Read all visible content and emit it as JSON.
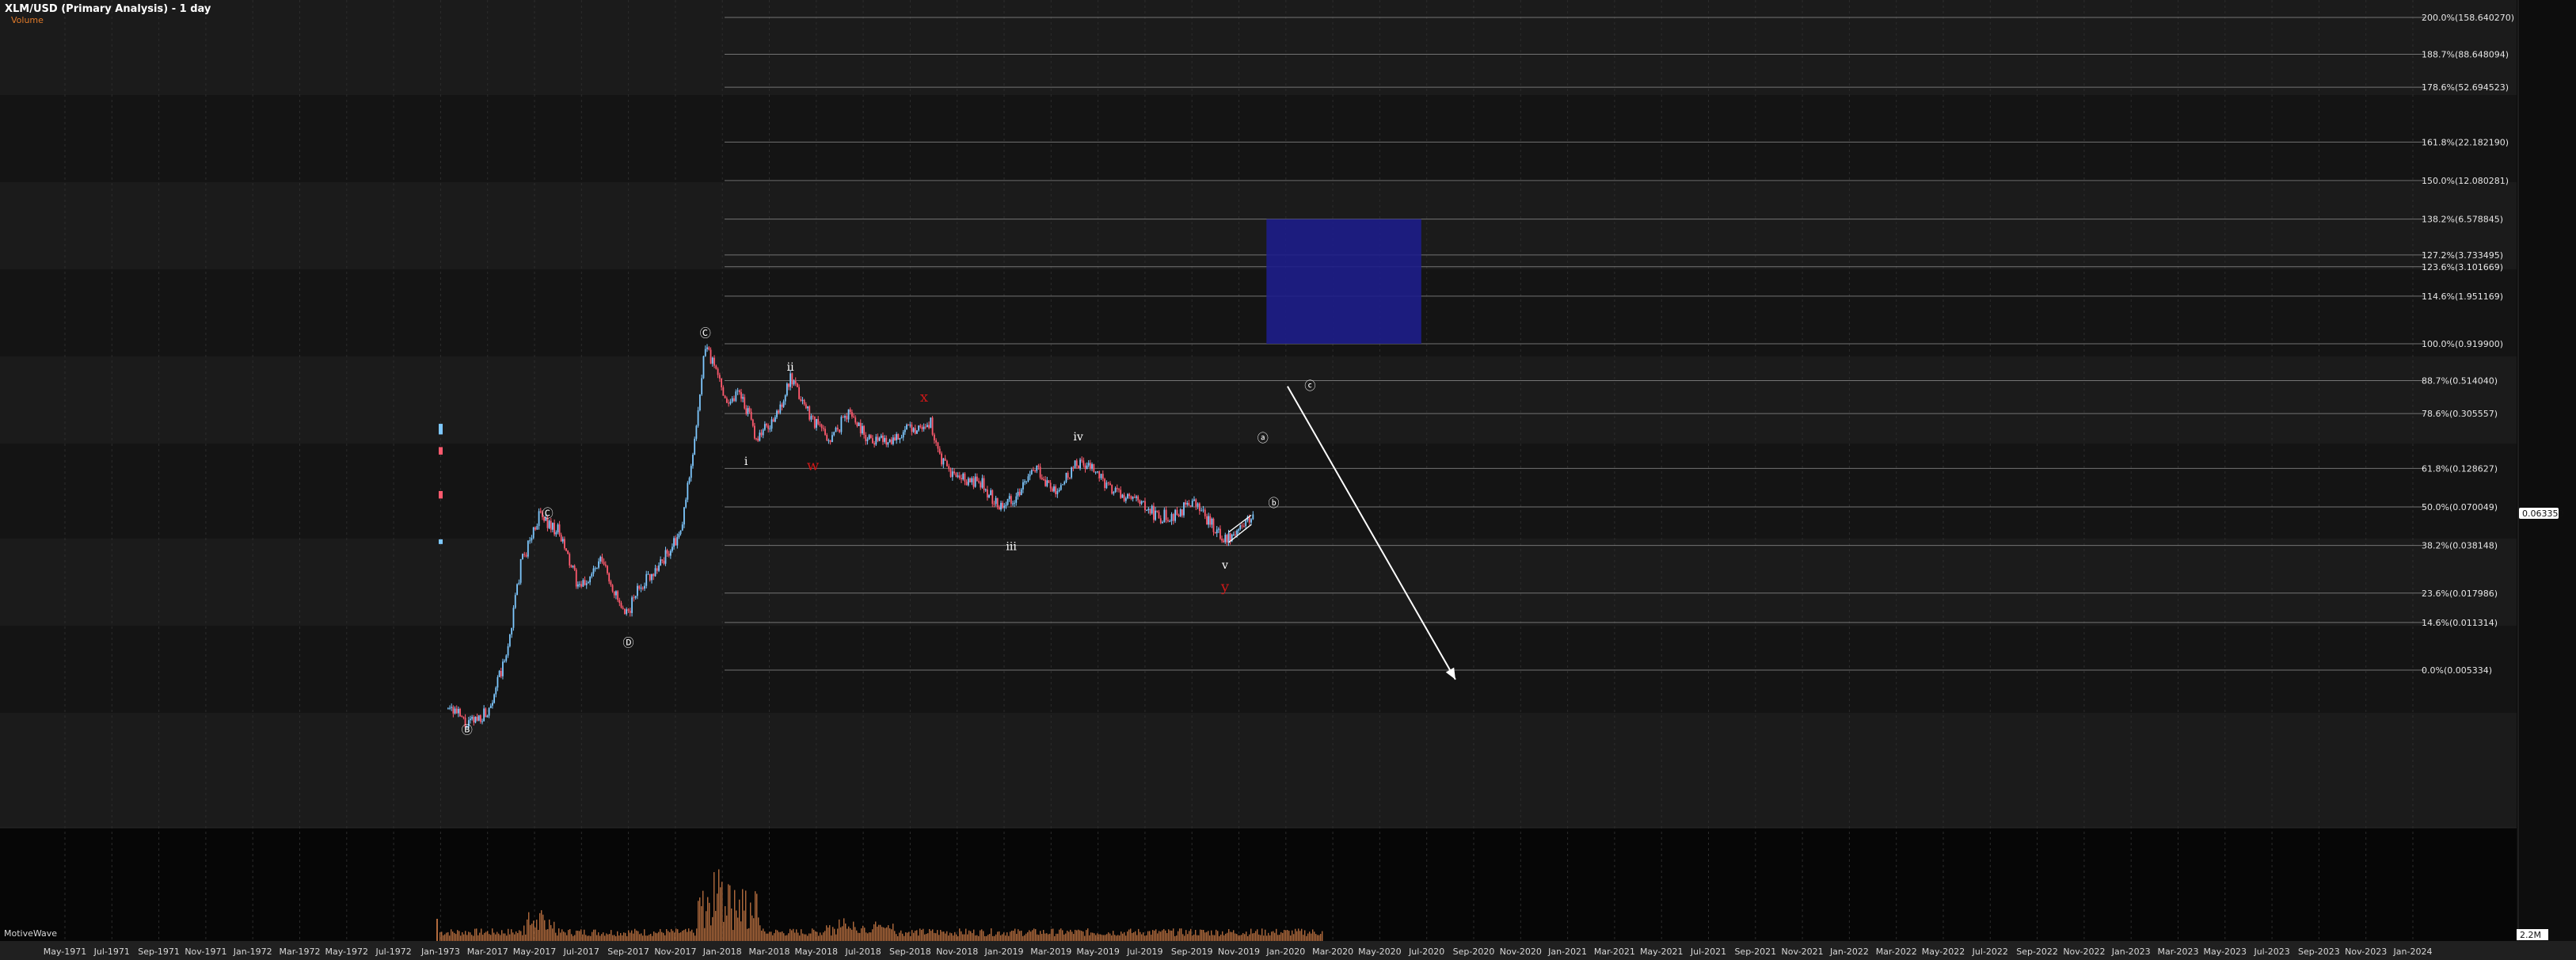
{
  "header": {
    "title": "XLM/USD (Primary Analysis) - 1 day",
    "subtitle": "Volume"
  },
  "footer": {
    "brand": "MotiveWave"
  },
  "colors": {
    "background": "#0d0d0d",
    "band_light": "#1b1b1b",
    "band_dark": "#141414",
    "volume_pane": "#060606",
    "up_candle": "#7ec8ff",
    "down_candle": "#ff5a6e",
    "volume_bar": "#b06a3c",
    "fib_line": "#9a9a9a",
    "target_box": "#1d1d8a",
    "wave_label_red": "#d01818",
    "wave_label_white": "#ffffff",
    "price_tag_bg": "#ffffff"
  },
  "chart_data": {
    "type": "candlestick",
    "symbol": "XLM/USD",
    "timeframe": "1 day",
    "y_scale": "log",
    "current_price": "0.063350",
    "volume_axis_label": "2.2M",
    "x_tick_labels": [
      "May-1971",
      "Jul-1971",
      "Sep-1971",
      "Nov-1971",
      "Jan-1972",
      "Mar-1972",
      "May-1972",
      "Jul-1972",
      "Jan-1973",
      "Mar-2017",
      "May-2017",
      "Jul-2017",
      "Sep-2017",
      "Nov-2017",
      "Jan-2018",
      "Mar-2018",
      "May-2018",
      "Jul-2018",
      "Sep-2018",
      "Nov-2018",
      "Jan-2019",
      "Mar-2019",
      "May-2019",
      "Jul-2019",
      "Sep-2019",
      "Nov-2019",
      "Jan-2020",
      "Mar-2020",
      "May-2020",
      "Jul-2020",
      "Sep-2020",
      "Nov-2020",
      "Jan-2021",
      "Mar-2021",
      "May-2021",
      "Jul-2021",
      "Sep-2021",
      "Nov-2021",
      "Jan-2022",
      "Mar-2022",
      "May-2022",
      "Jul-2022",
      "Sep-2022",
      "Nov-2022",
      "Jan-2023",
      "Mar-2023",
      "May-2023",
      "Jul-2023",
      "Sep-2023",
      "Nov-2023",
      "Jan-2024"
    ],
    "fib_levels": [
      {
        "label": "200.0%(158.640270)",
        "value": 158.64027
      },
      {
        "label": "188.7%(88.648094)",
        "value": 88.648094
      },
      {
        "label": "178.6%(52.694523)",
        "value": 52.694523
      },
      {
        "label": "161.8%(22.182190)",
        "value": 22.18219
      },
      {
        "label": "150.0%(12.080281)",
        "value": 12.080281
      },
      {
        "label": "138.2%(6.578845)",
        "value": 6.578845
      },
      {
        "label": "127.2%(3.733495)",
        "value": 3.733495
      },
      {
        "label": "123.6%(3.101669)",
        "value": 3.101669
      },
      {
        "label": "114.6%(1.951169)",
        "value": 1.951169
      },
      {
        "label": "100.0%(0.919900)",
        "value": 0.9199
      },
      {
        "label": "88.7%(0.514040)",
        "value": 0.51404
      },
      {
        "label": "78.6%(0.305557)",
        "value": 0.305557
      },
      {
        "label": "61.8%(0.128627)",
        "value": 0.128627
      },
      {
        "label": "50.0%(0.070049)",
        "value": 0.070049
      },
      {
        "label": "38.2%(0.038148)",
        "value": 0.038148
      },
      {
        "label": "23.6%(0.017986)",
        "value": 0.017986
      },
      {
        "label": "14.6%(0.011314)",
        "value": 0.011314
      },
      {
        "label": "0.0%(0.005334)",
        "value": 0.005334
      }
    ],
    "target_box": {
      "x_start": "2020-02-15",
      "x_end": "2020-09-15",
      "y_low": 0.9199,
      "y_high": 6.578845
    },
    "projection_arrow": {
      "from_date": "2020-03-15",
      "from_value": 0.47,
      "to_date": "2020-11-01",
      "to_value": 0.0046
    },
    "wave_labels": [
      {
        "text": "Ⓑ",
        "date": "2017-02-10",
        "value": 0.00195,
        "color": "white",
        "circled": false
      },
      {
        "text": "Ⓒ",
        "date": "2017-06-01",
        "value": 0.0595,
        "color": "white",
        "circled": false
      },
      {
        "text": "Ⓓ",
        "date": "2017-09-20",
        "value": 0.0077,
        "color": "white",
        "circled": false
      },
      {
        "text": "Ⓒ",
        "date": "2018-01-04",
        "value": 1.02,
        "color": "white",
        "circled": false
      },
      {
        "text": "i",
        "date": "2018-03-01",
        "value": 0.136,
        "color": "white",
        "circled": false
      },
      {
        "text": "ii",
        "date": "2018-05-01",
        "value": 0.6,
        "color": "white",
        "circled": false
      },
      {
        "text": "w",
        "date": "2018-06-01",
        "value": 0.125,
        "color": "red",
        "circled": false
      },
      {
        "text": "x",
        "date": "2018-11-01",
        "value": 0.37,
        "color": "red",
        "circled": false
      },
      {
        "text": "iii",
        "date": "2019-03-01",
        "value": 0.0355,
        "color": "white",
        "circled": false
      },
      {
        "text": "iv",
        "date": "2019-06-01",
        "value": 0.2,
        "color": "white",
        "circled": false
      },
      {
        "text": "v",
        "date": "2019-12-20",
        "value": 0.0265,
        "color": "white",
        "circled": false
      },
      {
        "text": "y",
        "date": "2019-12-20",
        "value": 0.0185,
        "color": "red",
        "circled": false
      },
      {
        "text": "ⓐ",
        "date": "2020-02-10",
        "value": 0.195,
        "color": "white",
        "circled": false
      },
      {
        "text": "ⓑ",
        "date": "2020-02-25",
        "value": 0.07,
        "color": "white",
        "circled": false
      },
      {
        "text": "ⓒ",
        "date": "2020-04-15",
        "value": 0.445,
        "color": "white",
        "circled": false
      }
    ],
    "channel_lines": [
      {
        "from_date": "2019-12-25",
        "from_value": 0.04,
        "to_date": "2020-01-25",
        "to_value": 0.053
      },
      {
        "from_date": "2019-12-25",
        "from_value": 0.047,
        "to_date": "2020-01-25",
        "to_value": 0.0615
      }
    ],
    "price_key_points": [
      {
        "date": "2017-01-15",
        "value": 0.0032
      },
      {
        "date": "2017-02-10",
        "value": 0.0022
      },
      {
        "date": "2017-03-10",
        "value": 0.0028
      },
      {
        "date": "2017-04-05",
        "value": 0.0065
      },
      {
        "date": "2017-04-25",
        "value": 0.028
      },
      {
        "date": "2017-05-20",
        "value": 0.061
      },
      {
        "date": "2017-06-15",
        "value": 0.048
      },
      {
        "date": "2017-07-15",
        "value": 0.019
      },
      {
        "date": "2017-08-15",
        "value": 0.03
      },
      {
        "date": "2017-09-15",
        "value": 0.012
      },
      {
        "date": "2017-10-05",
        "value": 0.02
      },
      {
        "date": "2017-11-01",
        "value": 0.028
      },
      {
        "date": "2017-12-01",
        "value": 0.045
      },
      {
        "date": "2017-12-25",
        "value": 0.3
      },
      {
        "date": "2018-01-04",
        "value": 0.91
      },
      {
        "date": "2018-02-05",
        "value": 0.36
      },
      {
        "date": "2018-02-20",
        "value": 0.45
      },
      {
        "date": "2018-03-15",
        "value": 0.21
      },
      {
        "date": "2018-04-10",
        "value": 0.28
      },
      {
        "date": "2018-05-01",
        "value": 0.52
      },
      {
        "date": "2018-06-01",
        "value": 0.28
      },
      {
        "date": "2018-06-25",
        "value": 0.2
      },
      {
        "date": "2018-07-20",
        "value": 0.32
      },
      {
        "date": "2018-08-15",
        "value": 0.21
      },
      {
        "date": "2018-09-10",
        "value": 0.2
      },
      {
        "date": "2018-10-15",
        "value": 0.24
      },
      {
        "date": "2018-11-10",
        "value": 0.26
      },
      {
        "date": "2018-11-25",
        "value": 0.14
      },
      {
        "date": "2018-12-15",
        "value": 0.11
      },
      {
        "date": "2019-01-20",
        "value": 0.1
      },
      {
        "date": "2019-02-10",
        "value": 0.072
      },
      {
        "date": "2019-03-10",
        "value": 0.085
      },
      {
        "date": "2019-04-05",
        "value": 0.13
      },
      {
        "date": "2019-05-01",
        "value": 0.085
      },
      {
        "date": "2019-05-30",
        "value": 0.14
      },
      {
        "date": "2019-06-20",
        "value": 0.13
      },
      {
        "date": "2019-07-15",
        "value": 0.092
      },
      {
        "date": "2019-08-20",
        "value": 0.075
      },
      {
        "date": "2019-09-20",
        "value": 0.06
      },
      {
        "date": "2019-10-15",
        "value": 0.062
      },
      {
        "date": "2019-11-05",
        "value": 0.077
      },
      {
        "date": "2019-11-25",
        "value": 0.058
      },
      {
        "date": "2019-12-18",
        "value": 0.042
      },
      {
        "date": "2020-01-10",
        "value": 0.05
      },
      {
        "date": "2020-01-30",
        "value": 0.0634
      }
    ],
    "legacy_candles": [
      {
        "date_label": "1972-10",
        "value_high": 0.26,
        "value_low": 0.22,
        "color": "blue"
      },
      {
        "date_label": "1972-10",
        "value_high": 0.18,
        "value_low": 0.16,
        "color": "red"
      },
      {
        "date_label": "1972-10",
        "value_high": 0.09,
        "value_low": 0.08,
        "color": "red"
      },
      {
        "date_label": "1972-10",
        "value_high": 0.042,
        "value_low": 0.039,
        "color": "blue"
      }
    ]
  }
}
